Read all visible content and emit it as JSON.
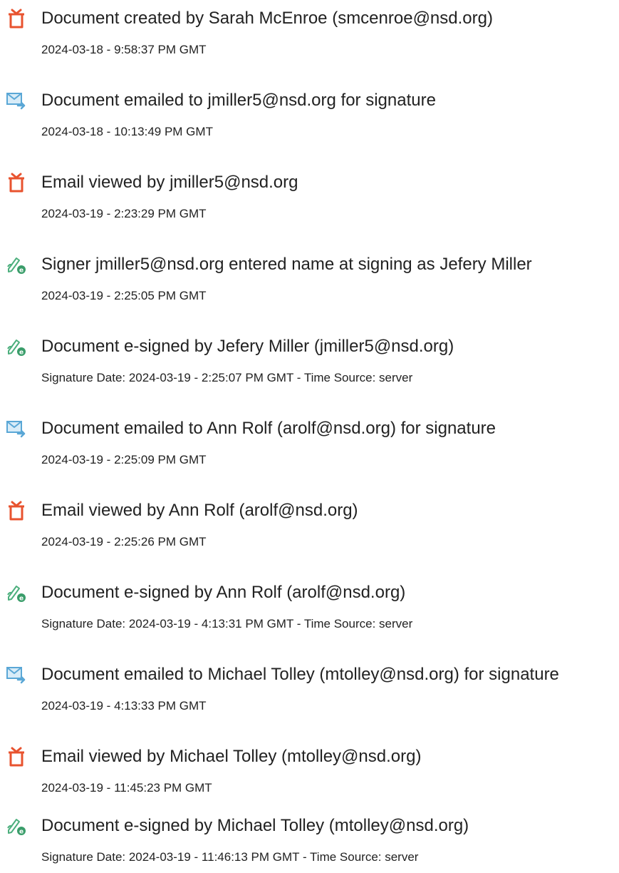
{
  "audit_trail": [
    {
      "icon": "document-created-icon",
      "title": "Document created by Sarah McEnroe (smcenroe@nsd.org)",
      "meta": "2024-03-18 - 9:58:37 PM GMT"
    },
    {
      "icon": "email-sent-icon",
      "title": "Document emailed to jmiller5@nsd.org for signature",
      "meta": "2024-03-18 - 10:13:49 PM GMT"
    },
    {
      "icon": "document-viewed-icon",
      "title": "Email viewed by jmiller5@nsd.org",
      "meta": "2024-03-19 - 2:23:29 PM GMT"
    },
    {
      "icon": "e-sign-icon",
      "title": "Signer jmiller5@nsd.org entered name at signing as Jefery Miller",
      "meta": "2024-03-19 - 2:25:05 PM GMT"
    },
    {
      "icon": "e-sign-icon",
      "title": "Document e-signed by Jefery Miller (jmiller5@nsd.org)",
      "meta": "Signature Date: 2024-03-19 - 2:25:07 PM GMT - Time Source: server"
    },
    {
      "icon": "email-sent-icon",
      "title": "Document emailed to Ann Rolf (arolf@nsd.org) for signature",
      "meta": "2024-03-19 - 2:25:09 PM GMT"
    },
    {
      "icon": "document-viewed-icon",
      "title": "Email viewed by Ann Rolf (arolf@nsd.org)",
      "meta": "2024-03-19 - 2:25:26 PM GMT"
    },
    {
      "icon": "e-sign-icon",
      "title": "Document e-signed by Ann Rolf (arolf@nsd.org)",
      "meta": "Signature Date: 2024-03-19 - 4:13:31 PM GMT - Time Source: server"
    },
    {
      "icon": "email-sent-icon",
      "title": "Document emailed to Michael Tolley (mtolley@nsd.org) for signature",
      "meta": "2024-03-19 - 4:13:33 PM GMT"
    },
    {
      "icon": "document-viewed-icon",
      "title": "Email viewed by Michael Tolley (mtolley@nsd.org)",
      "meta": "2024-03-19 - 11:45:23 PM GMT"
    },
    {
      "icon": "e-sign-icon",
      "title": "Document e-signed by Michael Tolley (mtolley@nsd.org)",
      "meta": "Signature Date: 2024-03-19 - 11:46:13 PM GMT - Time Source: server"
    }
  ],
  "colors": {
    "document_icon": "#e8532f",
    "email_icon": "#5aa7d6",
    "sign_icon": "#4caf7d",
    "text": "#222222"
  }
}
